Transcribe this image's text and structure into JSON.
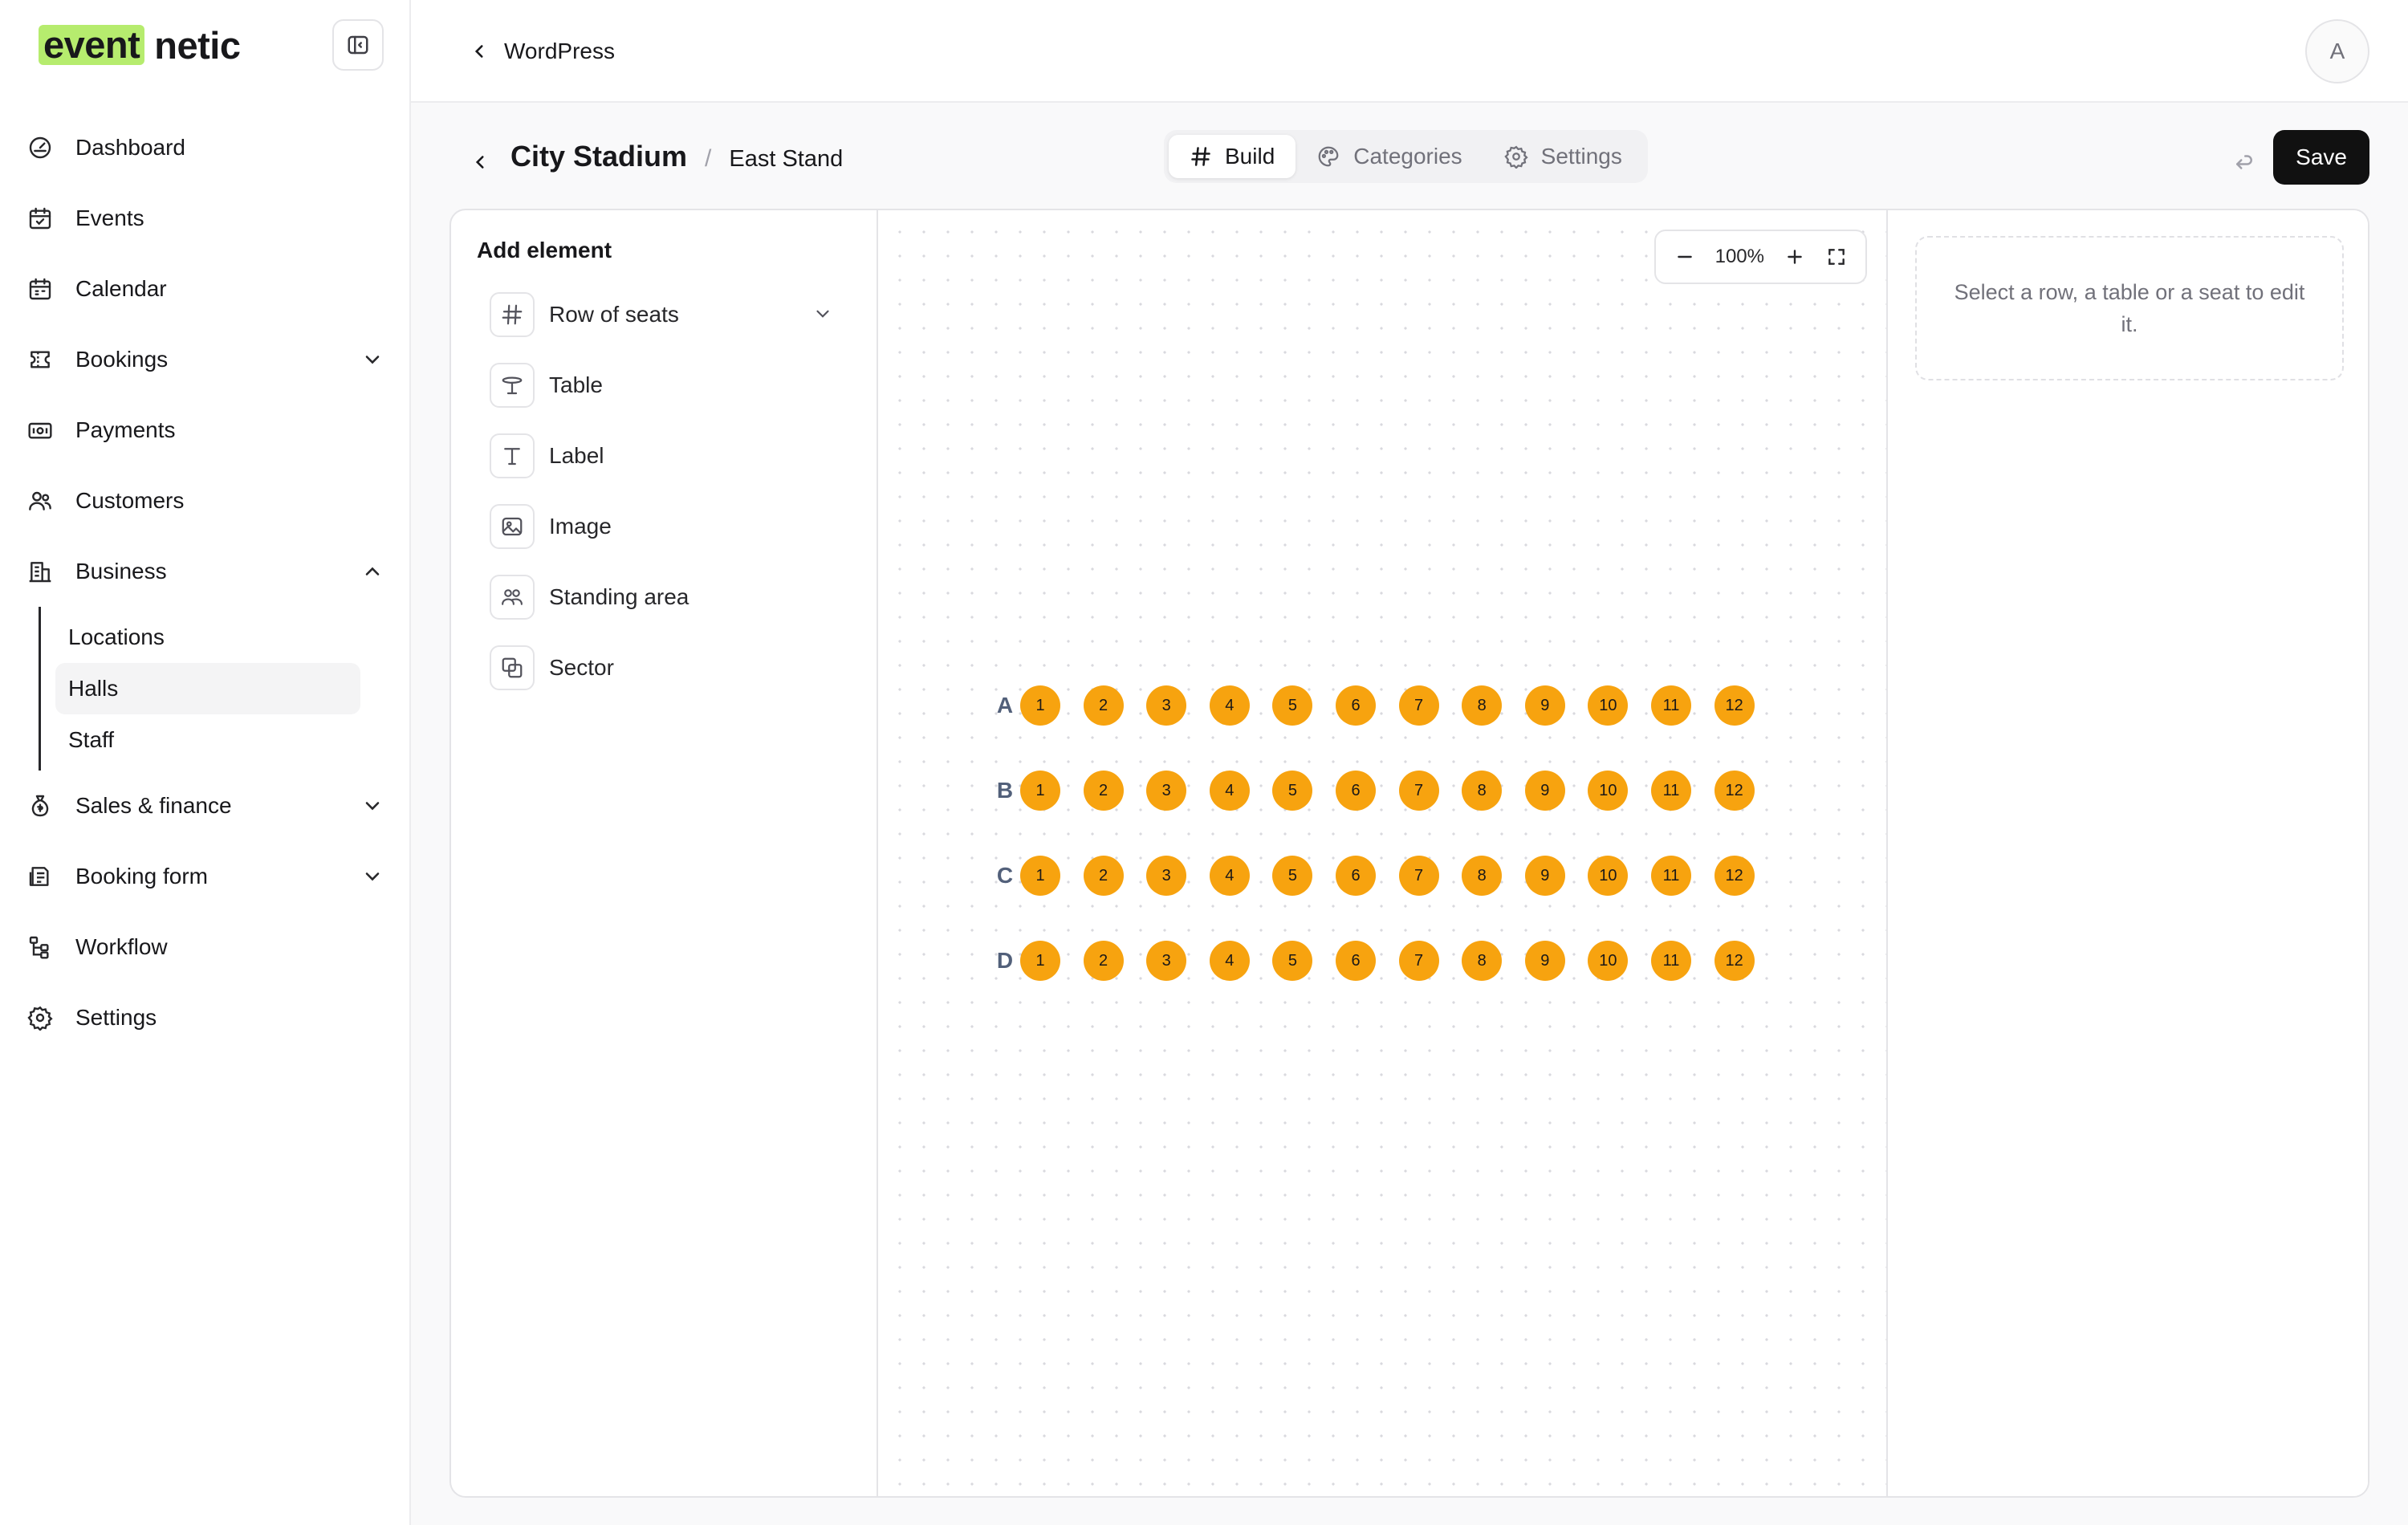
{
  "app": {
    "logo_highlight": "event",
    "logo_rest": "netic"
  },
  "sidebar": {
    "items": [
      {
        "key": "dashboard",
        "label": "Dashboard",
        "icon": "dashboard-icon"
      },
      {
        "key": "events",
        "label": "Events",
        "icon": "calendar-check-icon"
      },
      {
        "key": "calendar",
        "label": "Calendar",
        "icon": "calendar-icon"
      },
      {
        "key": "bookings",
        "label": "Bookings",
        "icon": "ticket-icon",
        "expandable": true,
        "expanded": false
      },
      {
        "key": "payments",
        "label": "Payments",
        "icon": "banknote-icon"
      },
      {
        "key": "customers",
        "label": "Customers",
        "icon": "users-icon"
      },
      {
        "key": "business",
        "label": "Business",
        "icon": "building-icon",
        "expandable": true,
        "expanded": true
      },
      {
        "key": "sales",
        "label": "Sales & finance",
        "icon": "money-bag-icon",
        "expandable": true,
        "expanded": false
      },
      {
        "key": "bookingform",
        "label": "Booking form",
        "icon": "form-icon",
        "expandable": true,
        "expanded": false
      },
      {
        "key": "workflow",
        "label": "Workflow",
        "icon": "workflow-icon"
      },
      {
        "key": "settings",
        "label": "Settings",
        "icon": "gear-icon"
      }
    ],
    "business_sub": [
      {
        "label": "Locations",
        "active": false
      },
      {
        "label": "Halls",
        "active": true
      },
      {
        "label": "Staff",
        "active": false
      }
    ]
  },
  "topbar": {
    "back_label": "WordPress",
    "avatar_initial": "A"
  },
  "header": {
    "venue": "City Stadium",
    "separator": "/",
    "stand": "East Stand",
    "tabs": [
      {
        "label": "Build",
        "active": true,
        "icon": "hash-icon"
      },
      {
        "label": "Categories",
        "active": false,
        "icon": "palette-icon"
      },
      {
        "label": "Settings",
        "active": false,
        "icon": "gear-icon"
      }
    ],
    "save_label": "Save"
  },
  "add_element": {
    "title": "Add element",
    "items": [
      {
        "label": "Row of seats",
        "icon": "hash-icon",
        "has_dropdown": true
      },
      {
        "label": "Table",
        "icon": "table-icon"
      },
      {
        "label": "Label",
        "icon": "text-icon"
      },
      {
        "label": "Image",
        "icon": "image-icon"
      },
      {
        "label": "Standing area",
        "icon": "users-icon"
      },
      {
        "label": "Sector",
        "icon": "sector-icon"
      }
    ]
  },
  "canvas": {
    "zoom": "100%",
    "seat_color": "#f7a30f",
    "rows": [
      {
        "label": "A",
        "seats": [
          "1",
          "2",
          "3",
          "4",
          "5",
          "6",
          "7",
          "8",
          "9",
          "10",
          "11",
          "12"
        ]
      },
      {
        "label": "B",
        "seats": [
          "1",
          "2",
          "3",
          "4",
          "5",
          "6",
          "7",
          "8",
          "9",
          "10",
          "11",
          "12"
        ]
      },
      {
        "label": "C",
        "seats": [
          "1",
          "2",
          "3",
          "4",
          "5",
          "6",
          "7",
          "8",
          "9",
          "10",
          "11",
          "12"
        ]
      },
      {
        "label": "D",
        "seats": [
          "1",
          "2",
          "3",
          "4",
          "5",
          "6",
          "7",
          "8",
          "9",
          "10",
          "11",
          "12"
        ]
      }
    ]
  },
  "inspector": {
    "hint": "Select a row, a table or a seat to edit it."
  }
}
